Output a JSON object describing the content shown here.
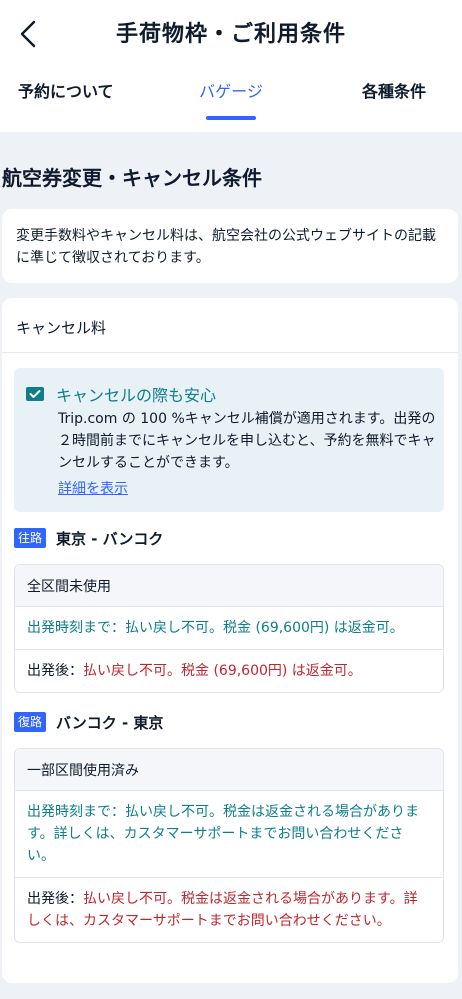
{
  "header": {
    "title": "手荷物枠・ご利用条件",
    "tabs": [
      {
        "label": "予約について",
        "active": false
      },
      {
        "label": "バゲージ",
        "active": true
      },
      {
        "label": "各種条件",
        "active": false
      }
    ]
  },
  "section": {
    "title": "航空券変更・キャンセル条件",
    "notice": "変更手数料やキャンセル料は、航空会社の公式ウェブサイトの記載に準じて徴収されております。"
  },
  "fees": {
    "header": "キャンセル料",
    "promo": {
      "title": "キャンセルの際も安心",
      "body": "Trip.com の 100 %キャンセル補償が適用されます。出発の２時間前までにキャンセルを申し込むと、予約を無料でキャンセルすることができます。",
      "link": "詳細を表示"
    },
    "outbound": {
      "badge": "往路",
      "route": "東京 - バンコク",
      "status": "全区間未使用",
      "before_label": "出発時刻まで：",
      "before_text": "払い戻し不可。税金 (69,600円) は返金可。",
      "after_label": "出発後：",
      "after_text": "払い戻し不可。税金 (69,600円) は返金可。"
    },
    "return": {
      "badge": "復路",
      "route": "バンコク - 東京",
      "status": "一部区間使用済み",
      "before_label": "出発時刻まで：",
      "before_text": "払い戻し不可。税金は返金される場合があります。詳しくは、カスタマーサポートまでお問い合わせください。",
      "after_label": "出発後：",
      "after_text": "払い戻し不可。税金は返金される場合があります。詳しくは、カスタマーサポートまでお問い合わせください。"
    }
  },
  "colors": {
    "accent": "#3264ff",
    "teal": "#0d7f8b",
    "red": "#c0272d"
  },
  "icons": {
    "back": "chevron-left-icon",
    "promo": "ticket-check-icon"
  }
}
